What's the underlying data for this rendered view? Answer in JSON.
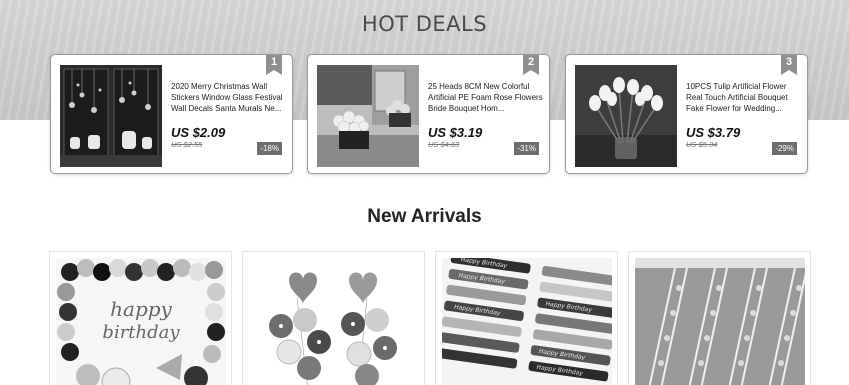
{
  "hot_deals": {
    "title": "HOT DEALS",
    "items": [
      {
        "rank": "1",
        "image_icon": "christmas-wall-stickers-image",
        "description": "2020 Merry Christmas Wall Stickers Window Glass Festival Wall Decals Santa Murals Ne...",
        "price": "US $2.09",
        "old_price": "US $2.55",
        "discount": "-18%"
      },
      {
        "rank": "2",
        "image_icon": "foam-rose-bouquet-image",
        "description": "25 Heads 8CM New Colorful Artificial PE Foam Rose Flowers Bride Bouquet Hom...",
        "price": "US $3.19",
        "old_price": "US $4.63",
        "discount": "-31%"
      },
      {
        "rank": "3",
        "image_icon": "tulip-bouquet-image",
        "description": "10PCS Tulip Artificial Flower Real Touch Artificial Bouquet Fake Flower for Wedding...",
        "price": "US $3.79",
        "old_price": "US $5.34",
        "discount": "-29%"
      }
    ]
  },
  "new_arrivals": {
    "title": "New Arrivals",
    "items": [
      {
        "image_icon": "happy-birthday-balloon-set-image",
        "image_text": "happy birthday"
      },
      {
        "image_icon": "heart-balloon-bouquet-image"
      },
      {
        "image_icon": "happy-birthday-ribbons-image",
        "image_text": "Happy Birthday"
      },
      {
        "image_icon": "lace-trim-ribbons-image"
      }
    ]
  },
  "colors": {
    "rank_badge": "#8f8f8f",
    "discount_badge": "#6e6e6e",
    "card_border": "#9a9a9a"
  }
}
